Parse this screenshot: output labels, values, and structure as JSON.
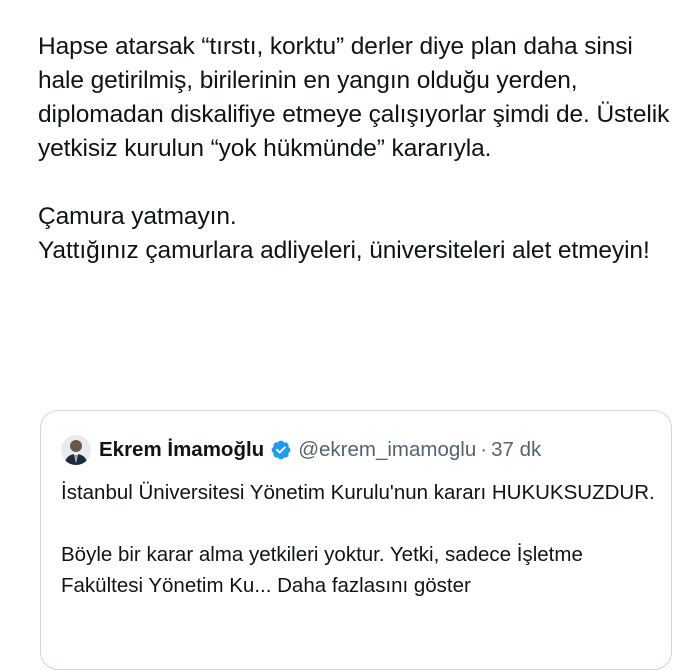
{
  "tweet": {
    "paragraph_1": "Hapse atarsak “tırstı, korktu” derler diye plan daha sinsi hale getirilmiş, birilerinin en yangın olduğu yerden, diplomadan diskalifiye etmeye çalışıyorlar şimdi de. Üstelik yetkisiz kurulun “yok hükmünde” kararıyla.",
    "paragraph_2_line_1": "Çamura yatmayın.",
    "paragraph_2_line_2": "Yattığınız çamurlara adliyeleri, üniversiteleri alet etmeyin!"
  },
  "quoted_tweet": {
    "author_name": "Ekrem İmamoğlu",
    "verified": true,
    "handle": "@ekrem_imamoglu",
    "separator": "·",
    "time_ago": "37 dk",
    "paragraph_1": "İstanbul Üniversitesi Yönetim Kurulu'nun kararı HUKUKSUZDUR.",
    "paragraph_2": "Böyle bir karar alma yetkileri yoktur. Yetki, sadece İşletme Fakültesi Yönetim Ku...",
    "show_more": "Daha fazlasını göster"
  },
  "colors": {
    "text": "#0f1419",
    "secondary_text": "#536471",
    "verified_blue": "#1d9bf0",
    "border": "#cfd9de"
  },
  "icons": {
    "avatar": "avatar",
    "verified": "verified-badge-icon"
  }
}
